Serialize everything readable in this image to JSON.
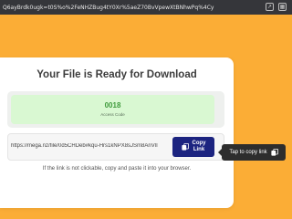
{
  "browser": {
    "url": "Q6ayBrdk0ugk=t0S%o%2FeNHZBug4tY0Xr%5aeZ70BvVpewXtBNhwPq%4Cy",
    "icons": [
      "share-icon",
      "extensions-icon"
    ]
  },
  "page": {
    "title": "Your File is Ready for Download",
    "access_code": {
      "value": "0018",
      "label": "Access Code"
    },
    "download_link": {
      "url": "https://mega.nz/file/0d5CHDeb#kqu-Hrs1kNPX8sJSm8AnVlI"
    },
    "copy_button": {
      "line1": "Copy",
      "line2": "Link"
    },
    "hint": "If the link is not clickable, copy and paste it into your browser.",
    "tooltip": "Tap to copy link"
  },
  "colors": {
    "background": "#FBAD36",
    "copy_button": "#1C2480",
    "code_text": "#3F9A3C",
    "code_box": "#D9F8D2"
  }
}
